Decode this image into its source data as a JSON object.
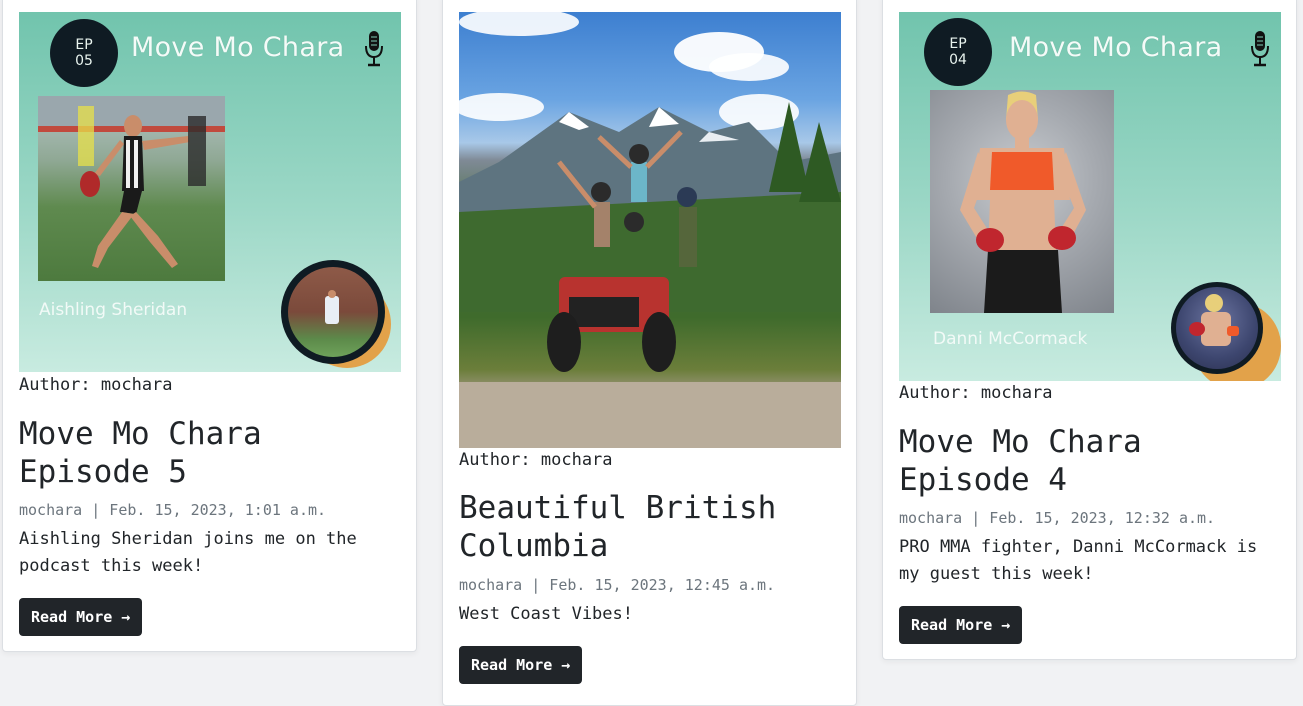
{
  "posts": [
    {
      "cover": {
        "ep_line1": "EP",
        "ep_line2": "05",
        "podcast_title": "Move Mo Chara",
        "guest_name": "Aishling Sheridan",
        "mic_icon": "microphone-icon"
      },
      "author": "Author: mochara",
      "title": "Move Mo Chara Episode 5",
      "meta": "mochara | Feb. 15, 2023, 1:01 a.m.",
      "excerpt": "Aishling Sheridan joins me on the podcast this week!",
      "button": "Read More →"
    },
    {
      "author": "Author: mochara",
      "title": "Beautiful British Columbia",
      "meta": "mochara | Feb. 15, 2023, 12:45 a.m.",
      "excerpt": "West Coast Vibes!",
      "button": "Read More →"
    },
    {
      "cover": {
        "ep_line1": "EP",
        "ep_line2": "04",
        "podcast_title": "Move Mo Chara",
        "guest_name": "Danni McCormack",
        "mic_icon": "microphone-icon"
      },
      "author": "Author: mochara",
      "title": "Move Mo Chara Episode 4",
      "meta": "mochara | Feb. 15, 2023, 12:32 a.m.",
      "excerpt": "PRO MMA fighter, Danni McCormack is my guest this week!",
      "button": "Read More →"
    }
  ],
  "colors": {
    "cover_gradient_top": "#71c4ad",
    "cover_badge": "#0f1b23",
    "avatar_accent": "#e2a24a",
    "button_bg": "#212529",
    "meta_text": "#6c757d"
  }
}
